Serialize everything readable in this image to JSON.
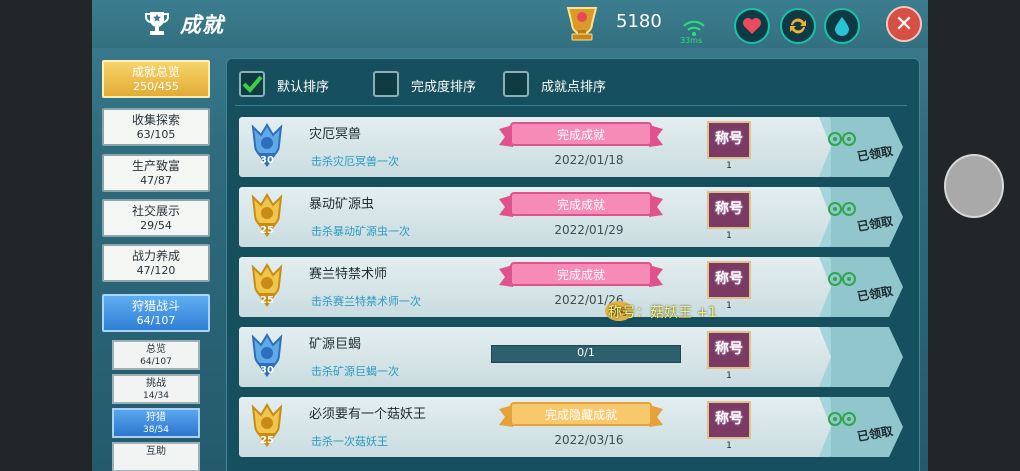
{
  "header": {
    "title": "成就",
    "points": "5180",
    "ping": "33ms"
  },
  "sidebar": [
    {
      "name": "成就总览",
      "count": "250/455",
      "state": "gold"
    },
    {
      "name": "收集探索",
      "count": "63/105",
      "state": "normal"
    },
    {
      "name": "生产致富",
      "count": "47/87",
      "state": "normal"
    },
    {
      "name": "社交展示",
      "count": "29/54",
      "state": "normal"
    },
    {
      "name": "战力养成",
      "count": "47/120",
      "state": "normal"
    },
    {
      "name": "狩猎战斗",
      "count": "64/107",
      "state": "blue"
    }
  ],
  "subtabs": [
    {
      "name": "总览",
      "count": "64/107",
      "active": false
    },
    {
      "name": "挑战",
      "count": "14/34",
      "active": false
    },
    {
      "name": "狩猎",
      "count": "38/54",
      "active": true
    },
    {
      "name": "互助",
      "count": "",
      "active": false
    }
  ],
  "sort": [
    {
      "label": "默认排序",
      "checked": true
    },
    {
      "label": "完成度排序",
      "checked": false
    },
    {
      "label": "成就点排序",
      "checked": false
    }
  ],
  "rows": [
    {
      "badge": "blue",
      "badge_points": "30",
      "name": "灾厄冥兽",
      "desc": "击杀灾厄冥兽一次",
      "status": "完成成就",
      "ribbon": "pink",
      "date": "2022/01/18",
      "progress": "",
      "reward": "称号",
      "reward_count": "1",
      "claim": "已领取"
    },
    {
      "badge": "gold",
      "badge_points": "25",
      "name": "暴动矿源虫",
      "desc": "击杀暴动矿源虫一次",
      "status": "完成成就",
      "ribbon": "pink",
      "date": "2022/01/29",
      "progress": "",
      "reward": "称号",
      "reward_count": "1",
      "claim": "已领取"
    },
    {
      "badge": "gold",
      "badge_points": "25",
      "name": "赛兰特禁术师",
      "desc": "击杀赛兰特禁术师一次",
      "status": "完成成就",
      "ribbon": "pink",
      "date": "2022/01/26",
      "progress": "",
      "reward": "称号",
      "reward_count": "1",
      "claim": "已领取"
    },
    {
      "badge": "blue",
      "badge_points": "30",
      "name": "矿源巨蝎",
      "desc": "击杀矿源巨蝎一次",
      "status": "",
      "ribbon": "",
      "date": "",
      "progress": "0/1",
      "reward": "称号",
      "reward_count": "1",
      "claim": ""
    },
    {
      "badge": "gold",
      "badge_points": "25",
      "name": "必须要有一个菇妖王",
      "desc": "击杀一次菇妖王",
      "status": "完成隐藏成就",
      "ribbon": "gold",
      "date": "2022/03/16",
      "progress": "",
      "reward": "称号",
      "reward_count": "1",
      "claim": "已领取"
    }
  ],
  "float_notice": {
    "badge": "称号",
    "text": "称号：菇妖王 +1"
  },
  "colors": {
    "accent_gold": "#e2ac35",
    "accent_blue": "#2f7fd6",
    "ribbon_pink": "#e0528e",
    "ribbon_gold": "#e7a13a",
    "panel_bg": "#16505e"
  }
}
